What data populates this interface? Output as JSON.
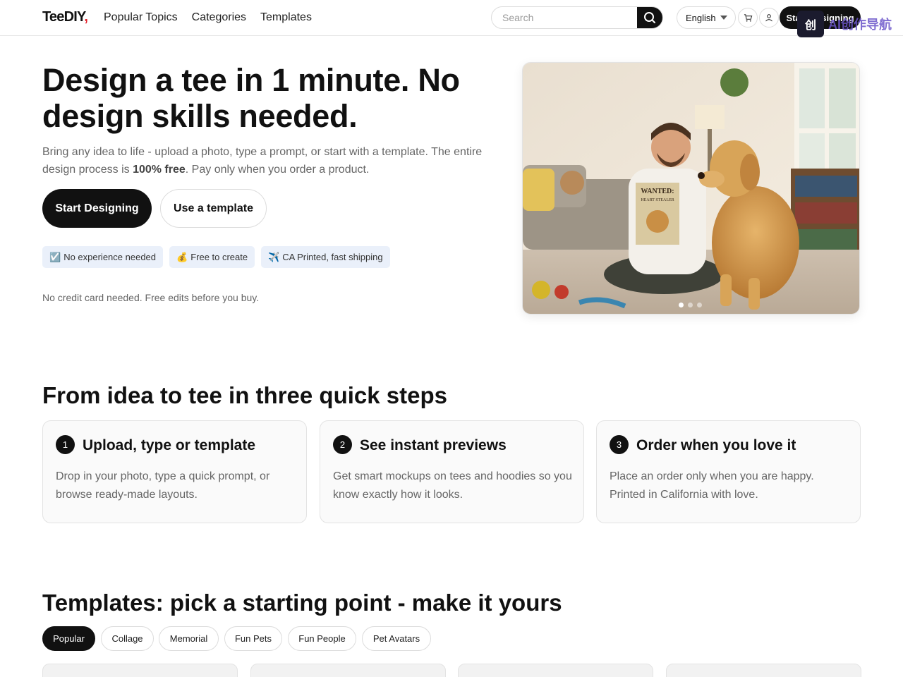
{
  "header": {
    "logo": "TeeDIY",
    "logo_mark": ",",
    "nav": [
      "Popular Topics",
      "Categories",
      "Templates"
    ],
    "search_placeholder": "Search",
    "language": "English",
    "cta": "Start Designing",
    "watermark_text": "AI创作导航"
  },
  "hero": {
    "title": "Design a tee in 1 minute. No design skills needed.",
    "subtitle_before": "Bring any idea to life - upload a photo, type a prompt, or start with a template. The entire design process is ",
    "subtitle_bold": "100% free",
    "subtitle_after": ". Pay only when you order a product.",
    "primary_button": "Start Designing",
    "secondary_button": "Use a template",
    "chips": [
      {
        "icon": "☑️",
        "label": "No experience needed"
      },
      {
        "icon": "💰",
        "label": "Free to create"
      },
      {
        "icon": "✈️",
        "label": "CA Printed, fast shipping"
      }
    ],
    "note": "No credit card needed. Free edits before you buy.",
    "image_shirt_text": "WANTED:",
    "image_shirt_sub": "HEART STEALER",
    "carousel_dots": 3,
    "carousel_active": 1
  },
  "steps": {
    "title": "From idea to tee in three quick steps",
    "items": [
      {
        "num": "1",
        "title": "Upload, type or template",
        "desc": "Drop in your photo, type a quick prompt, or browse ready-made layouts."
      },
      {
        "num": "2",
        "title": "See instant previews",
        "desc": "Get smart mockups on tees and hoodies so you know exactly how it looks."
      },
      {
        "num": "3",
        "title": "Order when you love it",
        "desc": "Place an order only when you are happy. Printed in California with love."
      }
    ]
  },
  "templates": {
    "title": "Templates: pick a starting point - make it yours",
    "tabs": [
      "Popular",
      "Collage",
      "Memorial",
      "Fun Pets",
      "Fun People",
      "Pet Avatars"
    ],
    "active_tab": "Popular"
  },
  "colors": {
    "primary": "#111111",
    "chip_bg": "#eaf0fa",
    "logo_accent": "#e4202a",
    "muted_text": "#666666"
  }
}
